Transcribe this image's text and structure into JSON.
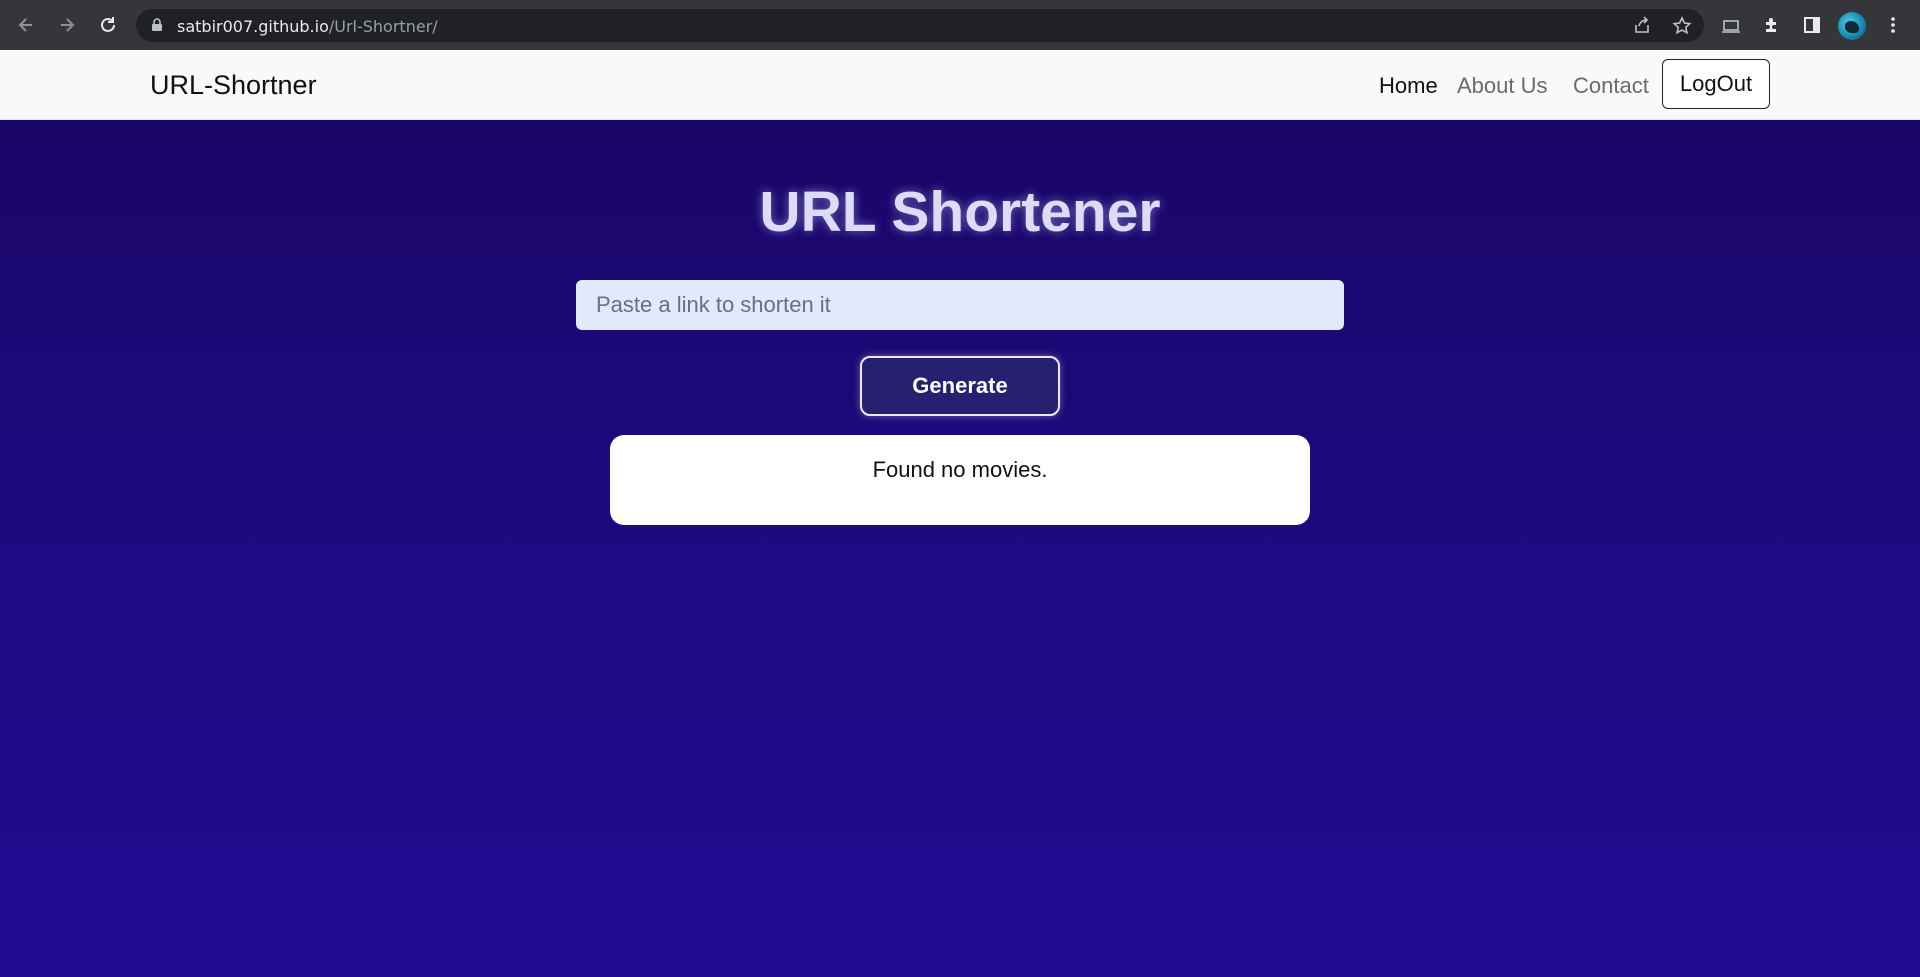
{
  "browser": {
    "url_host": "satbir007.github.io",
    "url_path": "/Url-Shortner/"
  },
  "navbar": {
    "brand": "URL-Shortner",
    "links": [
      "Home",
      "About Us",
      "Contact"
    ],
    "logout_label": "LogOut"
  },
  "main": {
    "title": "URL Shortener",
    "input_placeholder": "Paste a link to shorten it",
    "input_value": "",
    "generate_label": "Generate",
    "result_message": "Found no movies."
  },
  "colors": {
    "navbar_bg": "#f8f9fa",
    "page_bg": "#1d0a80",
    "input_bg": "#e1e9fb",
    "button_bg": "#272071",
    "card_bg": "#ffffff"
  }
}
